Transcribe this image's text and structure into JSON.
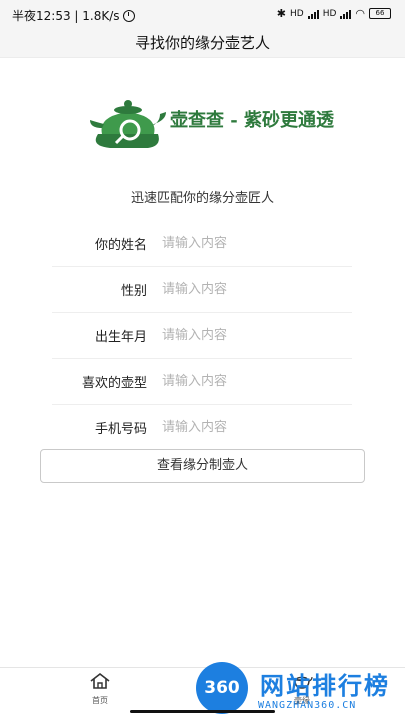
{
  "status_bar": {
    "time_text": "半夜12:53 | 1.8K/s",
    "signal_1": "HD",
    "signal_2": "HD",
    "battery": "66"
  },
  "header": {
    "title": "寻找你的缘分壶艺人"
  },
  "logo": {
    "text": "壶查查 - 紫砂更通透"
  },
  "subtitle": "迅速匹配你的缘分壶匠人",
  "form": {
    "fields": [
      {
        "label": "你的姓名",
        "placeholder": "请输入内容"
      },
      {
        "label": "性别",
        "placeholder": "请输入内容"
      },
      {
        "label": "出生年月",
        "placeholder": "请输入内容"
      },
      {
        "label": "喜欢的壶型",
        "placeholder": "请输入内容"
      },
      {
        "label": "手机号码",
        "placeholder": "请输入内容"
      }
    ],
    "submit_label": "查看缘分制壶人"
  },
  "tab_bar": {
    "tabs": [
      {
        "label": "首页",
        "icon": "home-icon"
      },
      {
        "label": "壶缘",
        "icon": "teapot-icon"
      }
    ]
  },
  "watermark": {
    "badge": "360",
    "title": "网站排行榜",
    "subtitle": "WANGZHAN360.CN",
    "color": "#1d7fe0"
  },
  "colors": {
    "brand_green": "#2e7a3d",
    "accent_green": "#3f9a4c"
  }
}
